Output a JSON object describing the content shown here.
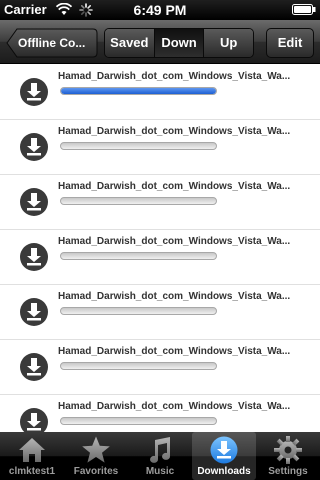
{
  "status_bar": {
    "carrier": "Carrier",
    "time": "6:49 PM"
  },
  "nav": {
    "back_label": "Offline Co...",
    "segments": [
      {
        "label": "Saved",
        "selected": false
      },
      {
        "label": "Down",
        "selected": true
      },
      {
        "label": "Up",
        "selected": false
      }
    ],
    "edit_label": "Edit"
  },
  "downloads": [
    {
      "name": "Hamad_Darwish_dot_com_Windows_Vista_Wa...",
      "progress": 1.0,
      "icon": "download-icon"
    },
    {
      "name": "Hamad_Darwish_dot_com_Windows_Vista_Wa...",
      "progress": 0.0,
      "icon": "download-icon"
    },
    {
      "name": "Hamad_Darwish_dot_com_Windows_Vista_Wa...",
      "progress": 0.0,
      "icon": "download-icon"
    },
    {
      "name": "Hamad_Darwish_dot_com_Windows_Vista_Wa...",
      "progress": 0.0,
      "icon": "download-icon"
    },
    {
      "name": "Hamad_Darwish_dot_com_Windows_Vista_Wa...",
      "progress": 0.0,
      "icon": "download-icon"
    },
    {
      "name": "Hamad_Darwish_dot_com_Windows_Vista_Wa...",
      "progress": 0.0,
      "icon": "download-icon"
    },
    {
      "name": "Hamad_Darwish_dot_com_Windows_Vista_Wa...",
      "progress": 0.0,
      "icon": "download-icon"
    }
  ],
  "tabs": [
    {
      "label": "clmktest1",
      "icon": "home-icon",
      "active": false
    },
    {
      "label": "Favorites",
      "icon": "star-icon",
      "active": false
    },
    {
      "label": "Music",
      "icon": "music-note-icon",
      "active": false
    },
    {
      "label": "Downloads",
      "icon": "download-icon",
      "active": true
    },
    {
      "label": "Settings",
      "icon": "gear-icon",
      "active": false
    }
  ],
  "colors": {
    "progress_fill": "#2b6fe0",
    "active_tab_icon": "#3aa0ff"
  }
}
